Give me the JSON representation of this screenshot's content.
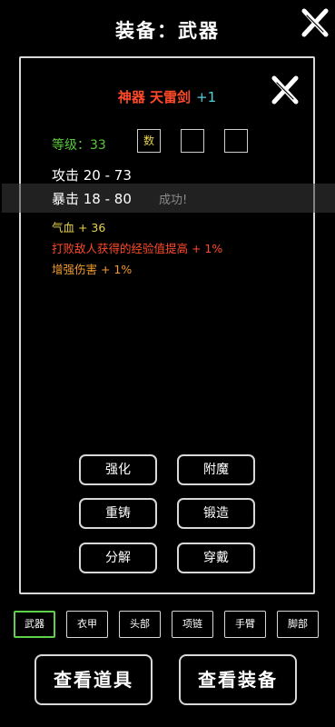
{
  "header": {
    "title": "装备：武器"
  },
  "item": {
    "name": "神器 天雷剑",
    "enhance": "+1",
    "level": "等级：33",
    "gem_slots": [
      "数",
      "",
      ""
    ],
    "stats": {
      "attack": "攻击 20 - 73",
      "crit": "暴击 18 - 80"
    },
    "toast": "成功!",
    "bonuses": [
      {
        "text": "气血 + 36",
        "color": "#e8d34a"
      },
      {
        "text": "打败敌人获得的经验值提高 + 1%",
        "color": "#ff4a2a"
      },
      {
        "text": "增强伤害 + 1%",
        "color": "#f29a2e"
      }
    ]
  },
  "actions": {
    "enhance": "强化",
    "enchant": "附魔",
    "recast": "重铸",
    "forge": "锻造",
    "dismantle": "分解",
    "equip": "穿戴"
  },
  "tabs": [
    "武器",
    "衣甲",
    "头部",
    "项链",
    "手臂",
    "脚部"
  ],
  "active_tab": "武器",
  "bottom": {
    "view_items": "查看道具",
    "view_equipment": "查看装备"
  },
  "colors": {
    "name": "#ff4a2a",
    "enhance": "#4fd1d9",
    "level": "#58c93c",
    "active_tab": "#5fd04a"
  },
  "icons": {
    "close_main": "close-x-icon",
    "close_panel": "close-x-icon"
  }
}
